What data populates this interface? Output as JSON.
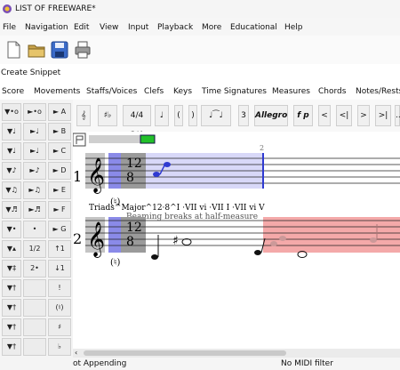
{
  "window": {
    "title": "LIST OF FREEWARE*"
  },
  "menu": [
    "File",
    "Navigation",
    "Edit",
    "View",
    "Input",
    "Playback",
    "More",
    "Educational",
    "Help"
  ],
  "snippet": {
    "label": "Create Snippet"
  },
  "tabs": [
    "Score",
    "Movements",
    "Staffs/Voices",
    "Clefs",
    "Keys",
    "Time Signatures",
    "Measures",
    "Chords",
    "Notes/Rests"
  ],
  "palette": {
    "rows": [
      [
        "▼•o",
        "►•o",
        "► A"
      ],
      [
        "▼♩",
        "►♩",
        "► B"
      ],
      [
        "▼♩",
        "►♩",
        "► C"
      ],
      [
        "▼♪",
        "►♪",
        "► D"
      ],
      [
        "▼♫",
        "►♫",
        "► E"
      ],
      [
        "▼♬",
        "►♬",
        "► F"
      ],
      [
        "▼•",
        "•",
        "► G"
      ],
      [
        "▼▴",
        "1/2",
        "↑1"
      ],
      [
        "▼‡",
        "2•",
        "↓1"
      ],
      [
        "▼†",
        "",
        "!"
      ],
      [
        "▼†",
        "",
        "(♮)"
      ],
      [
        "▼†",
        "",
        "♯"
      ],
      [
        "▼†",
        "",
        "♭"
      ]
    ]
  },
  "notebar": {
    "buttons": [
      "𝄞",
      "♯♭",
      "4/4 3/4",
      "♩",
      "(",
      ")",
      "♩⁀♩",
      "3",
      "Allegro",
      "f p",
      "<",
      "<|",
      ">",
      ">|",
      "..."
    ]
  },
  "score": {
    "measure_number": "2",
    "staff1": {
      "number": "1",
      "time_sig_top": "12",
      "time_sig_bottom": "8",
      "key_mark": "(♮)"
    },
    "staff2": {
      "number": "2",
      "time_sig_top": "12",
      "time_sig_bottom": "8",
      "key_mark": "(♮)"
    },
    "lyric": "Triads^Major^12·8^I ·VII vi ·VII I ·VII vi V",
    "annotation": "Beaming breaks at half-measure"
  },
  "status": {
    "left": "ot Appending",
    "right": "No MIDI filter"
  },
  "colors": {
    "selection_blue": "#d8d8f8",
    "selection_red": "#f4a9a9",
    "cursor_blue": "#2f3ad1"
  }
}
